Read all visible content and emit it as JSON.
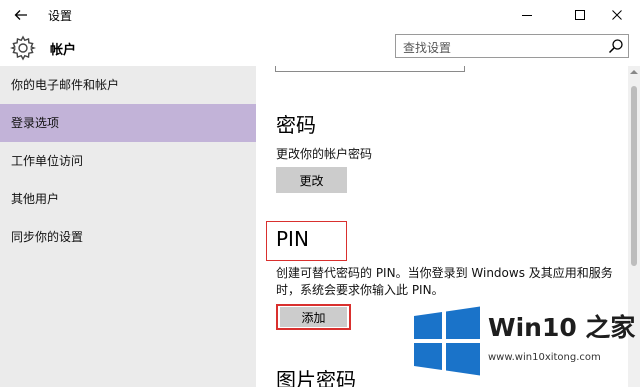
{
  "window": {
    "title": "设置"
  },
  "header": {
    "title": "帐户",
    "search_placeholder": "查找设置"
  },
  "sidebar": {
    "items": [
      {
        "label": "你的电子邮件和帐户",
        "selected": false
      },
      {
        "label": "登录选项",
        "selected": true
      },
      {
        "label": "工作单位访问",
        "selected": false
      },
      {
        "label": "其他用户",
        "selected": false
      },
      {
        "label": "同步你的设置",
        "selected": false
      }
    ]
  },
  "main": {
    "password": {
      "title": "密码",
      "desc": "更改你的帐户密码",
      "button": "更改"
    },
    "pin": {
      "title": "PIN",
      "desc_line1": "创建可替代密码的 PIN。当你登录到 Windows 及其应用和服务",
      "desc_line2": "时，系统会要求你输入此 PIN。",
      "button": "添加"
    },
    "picture_password": {
      "title": "图片密码"
    }
  },
  "watermark": {
    "name": "Win10 之家",
    "url": "www.win10xitong.com"
  },
  "colors": {
    "selected_bg": "#c2b3d8",
    "sidebar_bg": "#ebebeb",
    "button_bg": "#cccccc",
    "highlight": "#d9302e",
    "logo_blue": "#1a73c9"
  },
  "icons": [
    "back-arrow-icon",
    "minimize-icon",
    "maximize-icon",
    "close-icon",
    "gear-icon",
    "search-icon",
    "windows-logo-icon"
  ]
}
